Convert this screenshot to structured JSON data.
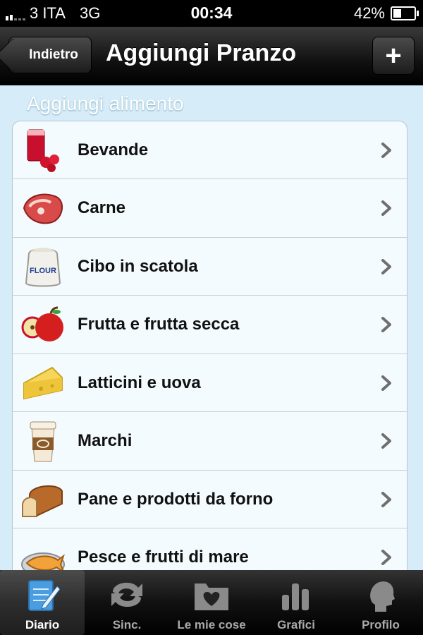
{
  "status_bar": {
    "carrier": "3 ITA",
    "network": "3G",
    "time": "00:34",
    "battery_percent_label": "42%",
    "battery_level": 0.42
  },
  "navbar": {
    "back_label": "Indietro",
    "title": "Aggiungi Pranzo",
    "add_label": "+"
  },
  "section": {
    "header": "Aggiungi alimento"
  },
  "categories": [
    {
      "label": "Bevande",
      "icon": "drink-glass-icon"
    },
    {
      "label": "Carne",
      "icon": "steak-icon"
    },
    {
      "label": "Cibo in scatola",
      "icon": "flour-sack-icon",
      "icon_text": "FLOUR"
    },
    {
      "label": "Frutta e frutta secca",
      "icon": "apple-icon"
    },
    {
      "label": "Latticini e uova",
      "icon": "cheese-icon"
    },
    {
      "label": "Marchi",
      "icon": "coffee-cup-icon"
    },
    {
      "label": "Pane e prodotti da forno",
      "icon": "bread-icon"
    },
    {
      "label": "Pesce e frutti di mare",
      "icon": "fish-plate-icon"
    }
  ],
  "tabbar": {
    "tabs": [
      {
        "label": "Diario",
        "icon": "diary-notepad-icon",
        "active": true
      },
      {
        "label": "Sinc.",
        "icon": "sync-icon",
        "active": false
      },
      {
        "label": "Le mie cose",
        "icon": "heart-folder-icon",
        "active": false
      },
      {
        "label": "Grafici",
        "icon": "bar-chart-icon",
        "active": false
      },
      {
        "label": "Profilo",
        "icon": "profile-head-icon",
        "active": false
      }
    ]
  },
  "colors": {
    "background": "#d6ecf8",
    "active_tab_icon": "#4a9de0"
  }
}
